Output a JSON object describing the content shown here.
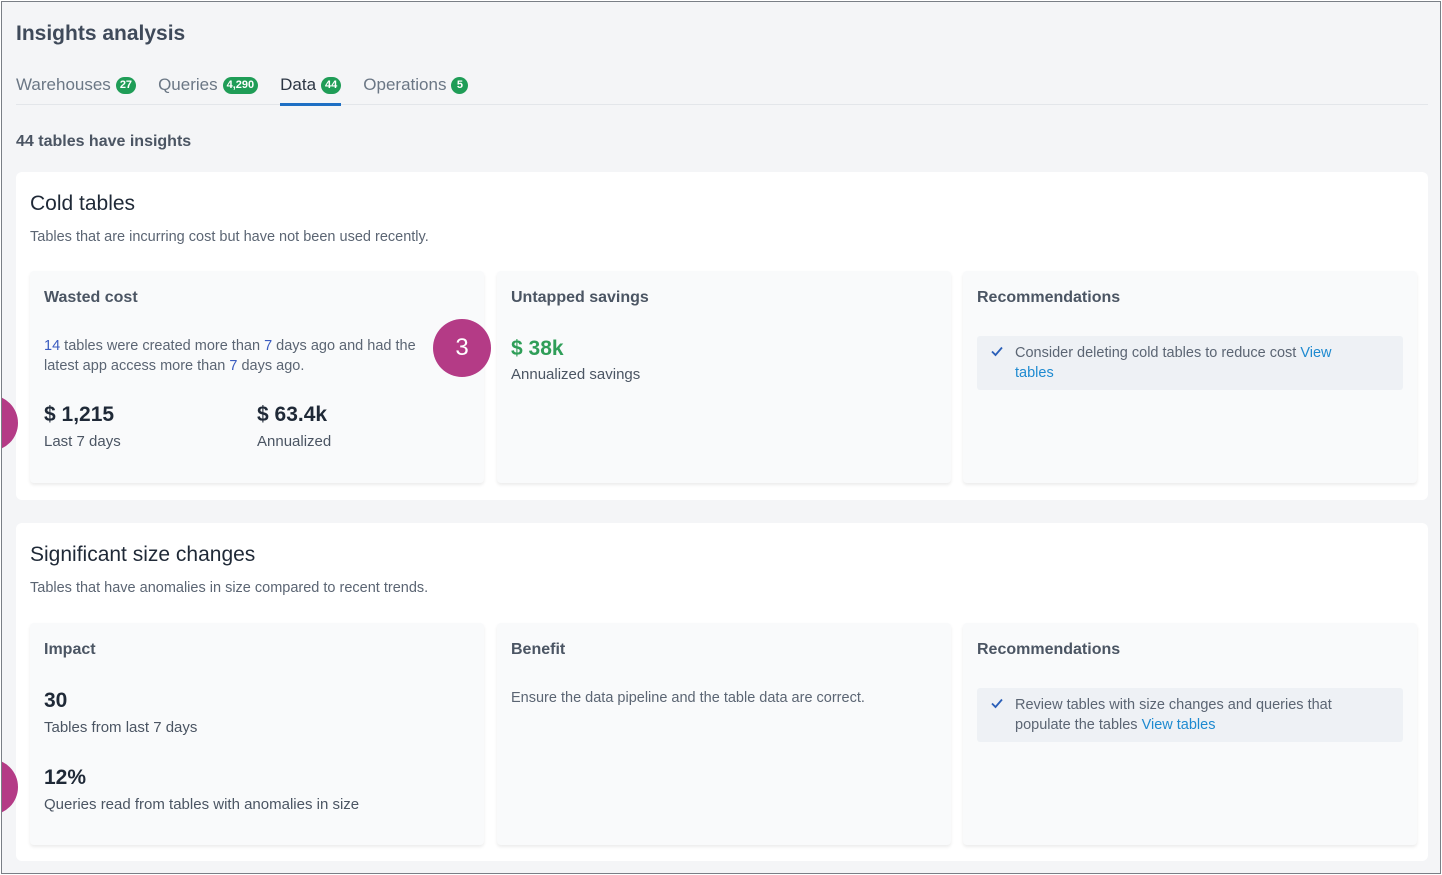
{
  "page": {
    "title": "Insights analysis"
  },
  "tabs": [
    {
      "label": "Warehouses",
      "count": "27"
    },
    {
      "label": "Queries",
      "count": "4,290"
    },
    {
      "label": "Data",
      "count": "44"
    },
    {
      "label": "Operations",
      "count": "5"
    }
  ],
  "summary": "44 tables have insights",
  "cold_tables": {
    "title": "Cold tables",
    "description": "Tables that are incurring cost but have not been used recently.",
    "wasted_cost": {
      "title": "Wasted cost",
      "count_tables": "14",
      "text_a": " tables were created more than ",
      "days_created": "7",
      "text_b": " days ago and had the",
      "text_c": "latest app access more than ",
      "days_access": "7",
      "text_d": " days ago.",
      "last7_value": "$ 1,215",
      "last7_label": "Last 7 days",
      "annual_value": "$ 63.4k",
      "annual_label": "Annualized"
    },
    "untapped": {
      "title": "Untapped savings",
      "value": "$ 38k",
      "label": "Annualized savings"
    },
    "recommendations": {
      "title": "Recommendations",
      "text": "Consider deleting cold tables to reduce cost ",
      "link_a": "View",
      "link_b": "tables"
    }
  },
  "size_changes": {
    "title": "Significant size changes",
    "description": "Tables that have anomalies in size compared to recent trends.",
    "impact": {
      "title": "Impact",
      "tables_value": "30",
      "tables_label": "Tables from last 7 days",
      "queries_value": "12%",
      "queries_label": "Queries read from tables with anomalies in size"
    },
    "benefit": {
      "title": "Benefit",
      "text": "Ensure the data pipeline and the table data are correct."
    },
    "recommendations": {
      "title": "Recommendations",
      "text_a": "Review tables with size changes and queries that",
      "text_b": "populate the tables ",
      "link": "View tables"
    }
  },
  "markers": {
    "step3": "3"
  },
  "colors": {
    "accent": "#1e6fc4",
    "badge": "#1f9d57",
    "savings": "#2f9e58",
    "marker": "#b43b86",
    "link": "#1e8ad0"
  }
}
